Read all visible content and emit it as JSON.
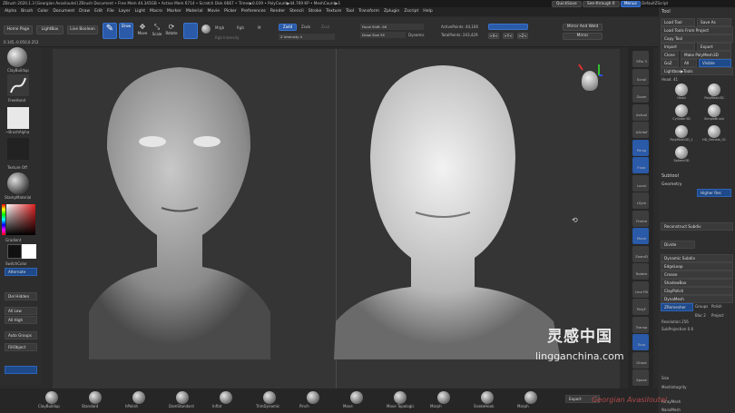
{
  "titlebar": "ZBrush 2020.1.3 [Georgian Avasiloutei]  ZBrush Document   • Free Mem 44.345GB • Active Mem 6714 • Scratch Disk 6667 • Timer▶0.039 • PolyCount▶44.769 KP • MeshCount▶1",
  "menu": [
    "Alpha",
    "Brush",
    "Color",
    "Document",
    "Draw",
    "Edit",
    "File",
    "Layer",
    "Light",
    "Macro",
    "Marker",
    "Material",
    "Movie",
    "Picker",
    "Preferences",
    "Render",
    "Stencil",
    "Stroke",
    "Texture",
    "Tool",
    "Transform",
    "Zplugin",
    "Zscript",
    "Help"
  ],
  "top_right": {
    "quicksave": "QuickSave",
    "see_through": "See-through 0",
    "menus": "Menus",
    "default_script": "DefaultZScript"
  },
  "shelf": {
    "home": "Home Page",
    "lightbox": "LightBox",
    "live_boolean": "Live Boolean",
    "edit": "Edit",
    "draw": "Draw",
    "move": "Move",
    "scale": "Scale",
    "rotate": "Rotate",
    "mrgb": "Mrgb",
    "rgb": "Rgb",
    "m": "M",
    "zadd": "Zadd",
    "zsub": "Zsub",
    "zcut": "Zcut",
    "rgb_intensity": "Rgb Intensity",
    "z_intensity": "Z Intensity 4",
    "focal_shift": "Focal Shift -56",
    "draw_size": "Draw Size 55",
    "dynamic": "Dynamic",
    "active_points": "ActivePoints: 44,166",
    "total_points": "TotalPoints: 243,429",
    "mirror_weld": "Mirror And Weld",
    "mirror": "Mirror",
    "coords": "0.145,-0.050,0.253"
  },
  "left": {
    "brush": "ClayBuildup",
    "stroke": "FreeHand",
    "alpha": "~BrushAlpha",
    "texture": "Texture Off",
    "material": "StampMaterial",
    "gradient": "Gradient",
    "switch": "SwitchColor",
    "alternate": "Alternate",
    "del_hidden": "Del Hidden",
    "all_low": "All Low",
    "all_high": "All High",
    "auto_groups": "Auto Groups",
    "fill_object": "FillObject"
  },
  "right_icons": [
    "SPix 3",
    "Scroll",
    "Zoom",
    "Actual",
    "AAHalf",
    "Persp",
    "Floor",
    "Local",
    "LSym",
    "Frame",
    "Move",
    "ZoomD",
    "Rotate",
    "Line Fill",
    "PolyF",
    "Transp",
    "Solo",
    "Ghost",
    "Xpose"
  ],
  "panel": {
    "tool": "Tool",
    "load_tool": "Load Tool",
    "save_as": "Save As",
    "load_project": "Load Tools From Project",
    "copy_tool": "Copy Tool",
    "import": "Import",
    "export": "Export",
    "clone": "Clone",
    "make_polymesh": "Make PolyMesh3D",
    "goz": "GoZ",
    "all": "All",
    "visible": "Visible",
    "lightbox_tools": "Lightbox▶Tools",
    "head": "Head. 41",
    "subtool": "Subtool",
    "geometry": "Geometry",
    "higher_res": "Higher Res",
    "reconstruct": "Reconstruct Subdiv",
    "divide": "Divide",
    "dynamic_subdiv": "Dynamic Subdiv",
    "edge_loop": "EdgeLoop",
    "crease": "Crease",
    "shadowbox": "ShadowBox",
    "claypolish": "ClayPolish",
    "dynamesh": "DynaMesh",
    "zremesher": "ZRemesher",
    "groups": "Groups",
    "polish": "Polish",
    "blur": "Blur 2",
    "project": "Project",
    "resolution": "Resolution 256",
    "subprojection": "SubProjection 0.6",
    "size": "Size",
    "meshintegrity": "MeshIntegrity",
    "arraymesh": "ArrayMesh",
    "nanomesh": "NanoMesh"
  },
  "tools": [
    "Head",
    "PolyMesh3D",
    "Cylinder3D",
    "SimpleBrush",
    "PolyMesh3D_1",
    "HD_Female_01",
    "Sphere3D"
  ],
  "bottom_brushes": [
    "ClayBuildup",
    "Standard",
    "hPolish",
    "DamStandard",
    "Inflat",
    "TrimDynamic",
    "Pinch",
    "Move",
    "Move Topologic",
    "Morph",
    "SnakeHook",
    "Morph"
  ],
  "export": "Export",
  "watermark": {
    "cn": "灵感中国",
    "url": "lingganchina.com"
  },
  "signature": "Georgian Avasiloutei"
}
